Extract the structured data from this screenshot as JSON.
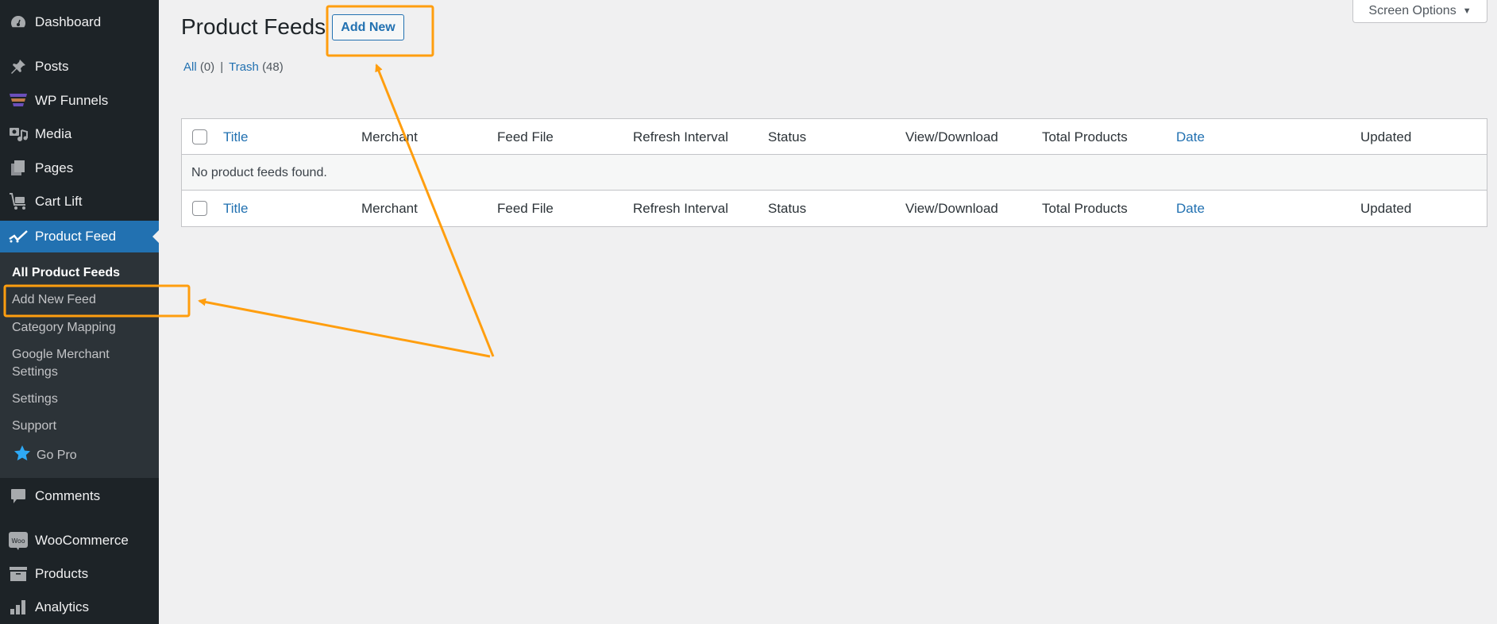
{
  "sidebar": {
    "items": [
      {
        "label": "Dashboard",
        "icon": "dashboard-icon"
      },
      {
        "label": "Posts",
        "icon": "pin-icon"
      },
      {
        "label": "WP Funnels",
        "icon": "funnel-icon"
      },
      {
        "label": "Media",
        "icon": "media-icon"
      },
      {
        "label": "Pages",
        "icon": "pages-icon"
      },
      {
        "label": "Cart Lift",
        "icon": "cart-icon"
      },
      {
        "label": "Product Feed",
        "icon": "product-feed-icon",
        "active": true
      },
      {
        "label": "Comments",
        "icon": "comment-icon"
      },
      {
        "label": "WooCommerce",
        "icon": "woo-icon"
      },
      {
        "label": "Products",
        "icon": "archive-icon"
      },
      {
        "label": "Analytics",
        "icon": "bar-chart-icon"
      }
    ],
    "submenu": [
      {
        "label": "All Product Feeds",
        "current": true
      },
      {
        "label": "Add New Feed"
      },
      {
        "label": "Category Mapping"
      },
      {
        "label": "Google Merchant Settings",
        "line1": "Google Merchant",
        "line2": "Settings"
      },
      {
        "label": "Settings"
      },
      {
        "label": "Support"
      },
      {
        "label": "Go Pro",
        "icon": "star-icon",
        "icon_color": "#2ea9f5"
      }
    ]
  },
  "header": {
    "title": "Product Feeds",
    "add_new_label": "Add New",
    "screen_options_label": "Screen Options",
    "screen_options_arrow": "▼"
  },
  "filters": {
    "all_label": "All",
    "all_count": "(0)",
    "separator": "|",
    "trash_label": "Trash",
    "trash_count": "(48)"
  },
  "table": {
    "columns": [
      {
        "label": "Title",
        "sortable": true
      },
      {
        "label": "Merchant",
        "sortable": false
      },
      {
        "label": "Feed File",
        "sortable": false
      },
      {
        "label": "Refresh Interval",
        "sortable": false
      },
      {
        "label": "Status",
        "sortable": false
      },
      {
        "label": "View/Download",
        "sortable": false
      },
      {
        "label": "Total Products",
        "sortable": false
      },
      {
        "label": "Date",
        "sortable": true
      },
      {
        "label": "Updated",
        "sortable": false
      }
    ],
    "empty_message": "No product feeds found."
  },
  "annotations": {
    "color": "#ff9e0f",
    "highlights": [
      "add-new-button",
      "submenu-add-new-feed"
    ]
  },
  "colors": {
    "sidebar_bg": "#1d2327",
    "submenu_bg": "#2c3338",
    "accent": "#2271b1",
    "page_bg": "#f0f0f1"
  }
}
